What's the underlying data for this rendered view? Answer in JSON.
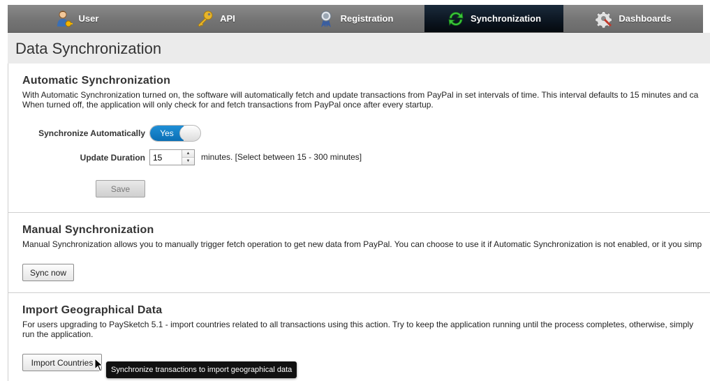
{
  "tabs": [
    {
      "label": "User",
      "icon": "user-icon"
    },
    {
      "label": "API",
      "icon": "key-icon"
    },
    {
      "label": "Registration",
      "icon": "ribbon-badge-icon"
    },
    {
      "label": "Synchronization",
      "icon": "sync-arrows-icon",
      "active": true
    },
    {
      "label": "Dashboards",
      "icon": "gear-wrench-icon"
    }
  ],
  "page": {
    "title": "Data Synchronization"
  },
  "auto_sync": {
    "heading": "Automatic Synchronization",
    "desc_line1": "With Automatic Synchronization turned on, the software will automatically fetch and update transactions from PayPal in set intervals of time. This interval defaults to 15 minutes and ca",
    "desc_line2": "When turned off, the application will only check for and fetch transactions from PayPal once after every startup.",
    "toggle_label": "Synchronize Automatically",
    "toggle_value": "Yes",
    "duration_label": "Update Duration",
    "duration_value": "15",
    "duration_hint": "minutes. [Select between 15 - 300 minutes]",
    "save_label": "Save"
  },
  "manual_sync": {
    "heading": "Manual Synchronization",
    "desc": "Manual Synchronization allows you to manually trigger fetch operation to get new data from PayPal. You can choose to use it if Automatic Synchronization is not enabled, or it you simp",
    "button_label": "Sync now"
  },
  "geo": {
    "heading": "Import Geographical Data",
    "desc_line1": "For users upgrading to PaySketch 5.1 - import countries related to all transactions using this action. Try to keep the application running until the process completes, otherwise, simply",
    "desc_line2": "run the application.",
    "button_label": "Import Countries",
    "tooltip": "Synchronize transactions to import geographical data"
  },
  "colors": {
    "tabbar": "#777777",
    "active_tab": "#0b1520",
    "toggle_on": "#0b6fb5",
    "title_bar": "#ebebeb"
  }
}
